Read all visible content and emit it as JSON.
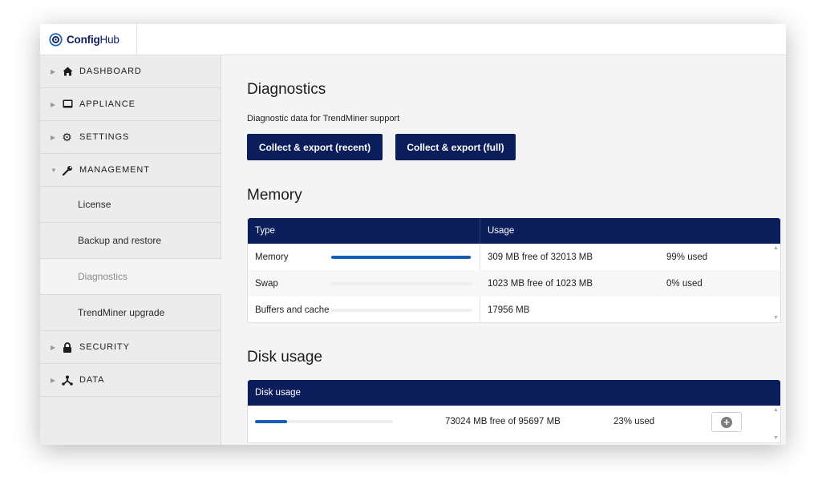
{
  "app": {
    "brand_strong": "Config",
    "brand_light": "Hub"
  },
  "sidebar": {
    "items": [
      {
        "label": "DASHBOARD",
        "icon": "home-icon"
      },
      {
        "label": "APPLIANCE",
        "icon": "monitor-icon"
      },
      {
        "label": "SETTINGS",
        "icon": "gear-icon"
      },
      {
        "label": "MANAGEMENT",
        "icon": "wrench-icon",
        "expanded": true
      },
      {
        "label": "SECURITY",
        "icon": "lock-icon"
      },
      {
        "label": "DATA",
        "icon": "network-icon"
      }
    ],
    "management_sub": [
      {
        "label": "License"
      },
      {
        "label": "Backup and restore"
      },
      {
        "label": "Diagnostics",
        "active": true
      },
      {
        "label": "TrendMiner upgrade"
      }
    ]
  },
  "diagnostics": {
    "title": "Diagnostics",
    "description": "Diagnostic data for TrendMiner support",
    "btn_recent": "Collect & export (recent)",
    "btn_full": "Collect & export (full)"
  },
  "memory": {
    "title": "Memory",
    "col_type": "Type",
    "col_usage": "Usage",
    "rows": [
      {
        "type": "Memory",
        "usage": "309 MB free of 32013 MB",
        "pct": "99% used",
        "fraction": 0.99
      },
      {
        "type": "Swap",
        "usage": "1023 MB free of 1023 MB",
        "pct": "0% used",
        "fraction": 0.0
      },
      {
        "type": "Buffers and cache",
        "usage": "17956 MB",
        "pct": "",
        "fraction": 0.0
      }
    ]
  },
  "disk": {
    "title": "Disk usage",
    "header": "Disk usage",
    "row": {
      "usage": "73024 MB free of 95697 MB",
      "pct": "23% used",
      "fraction": 0.23
    }
  },
  "colors": {
    "navy": "#0c1d5c",
    "accent_blue": "#1560b7"
  }
}
